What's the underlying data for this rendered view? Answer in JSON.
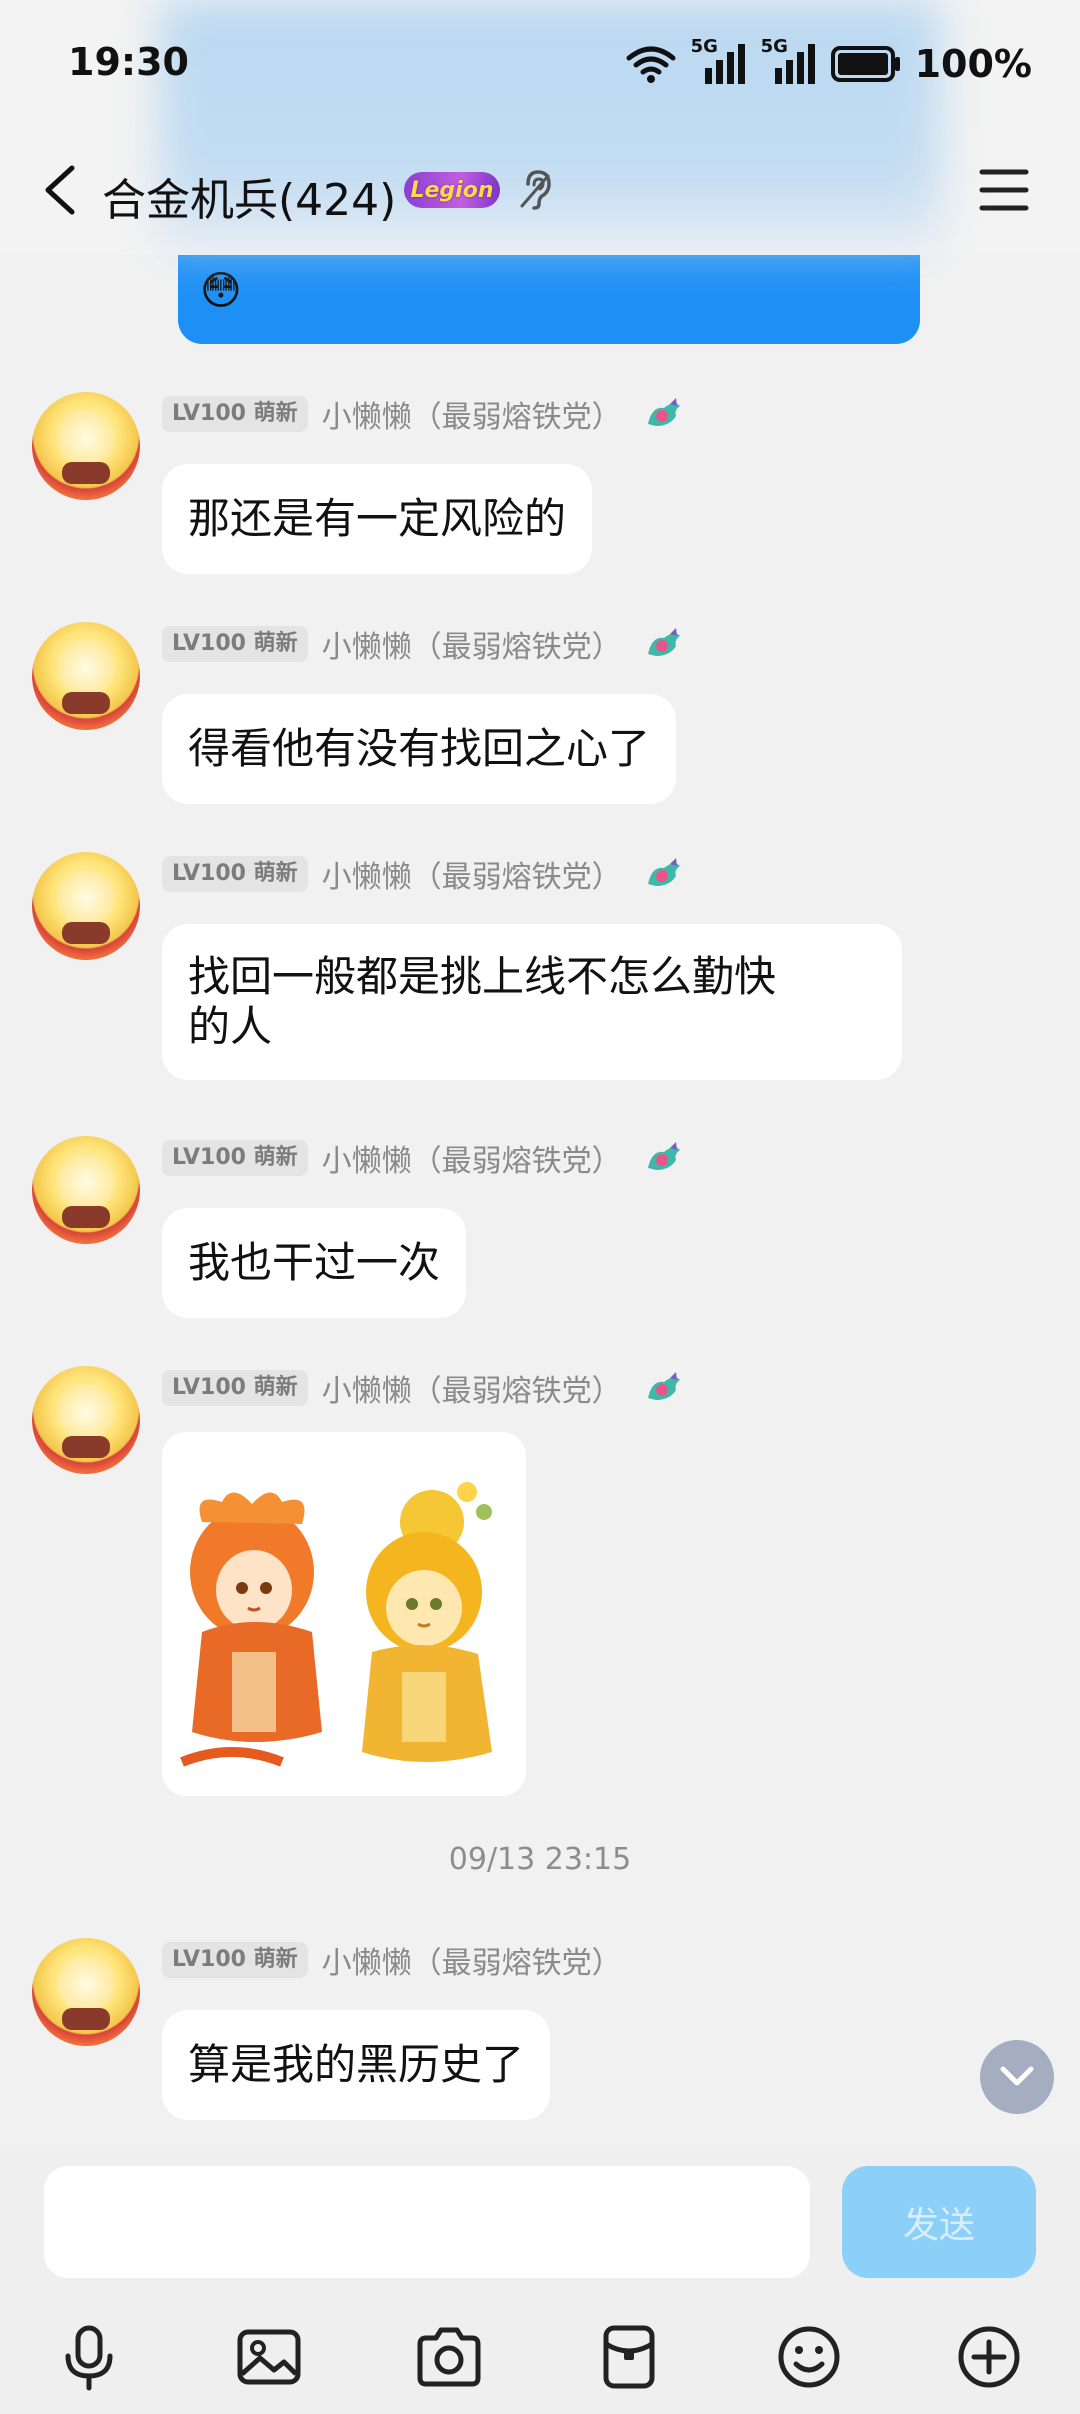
{
  "status": {
    "time": "19:30",
    "network_1": "5G",
    "network_2": "5G",
    "battery": "100%"
  },
  "header": {
    "title": "合金机兵(424)",
    "badge": "Legion"
  },
  "sent_message": {
    "emoji": "😳"
  },
  "messages": [
    {
      "level": "LV100 萌新",
      "sender": "小懒懒（最弱熔铁党）",
      "text": "那还是有一定风险的"
    },
    {
      "level": "LV100 萌新",
      "sender": "小懒懒（最弱熔铁党）",
      "text": "得看他有没有找回之心了"
    },
    {
      "level": "LV100 萌新",
      "sender": "小懒懒（最弱熔铁党）",
      "text_line1": "找回一般都是挑上线不怎么勤快",
      "text_line2": "的人"
    },
    {
      "level": "LV100 萌新",
      "sender": "小懒懒（最弱熔铁党）",
      "text": "我也干过一次"
    },
    {
      "level": "LV100 萌新",
      "sender": "小懒懒（最弱熔铁党）"
    },
    {
      "level": "LV100 萌新",
      "sender": "小懒懒（最弱熔铁党）",
      "text": "算是我的黑历史了"
    }
  ],
  "timestamp": "09/13 23:15",
  "composer": {
    "placeholder": "",
    "send_label": "发送"
  },
  "colors": {
    "sent_bubble": "#1e90f5",
    "send_button": "#8ccff7",
    "background": "#f1f1f1"
  }
}
